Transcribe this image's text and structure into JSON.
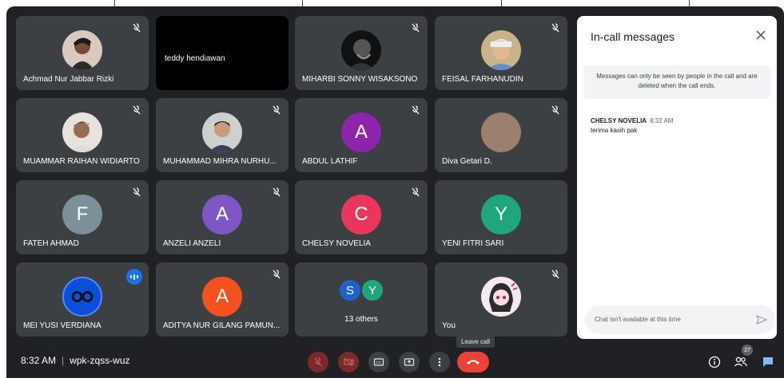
{
  "tiles": [
    {
      "name": "Achmad Nur Jabbar Rizki",
      "type": "photo",
      "muted": true
    },
    {
      "name": "teddy hendiawan",
      "type": "black",
      "muted": false
    },
    {
      "name": "MIHARBI SONNY WISAKSONO",
      "type": "photo",
      "muted": true
    },
    {
      "name": "FEISAL FARHANUDIN",
      "type": "photo",
      "muted": true
    },
    {
      "name": "MUAMMAR RAIHAN WIDIARTO",
      "type": "photo",
      "muted": true
    },
    {
      "name": "MUHAMMAD MIHRA NURHU...",
      "type": "photo",
      "muted": true
    },
    {
      "name": "ABDUL LATHIF",
      "type": "letter",
      "letter": "A",
      "color": "#8e24aa",
      "muted": true
    },
    {
      "name": "Diva Getari D.",
      "type": "photo",
      "muted": true
    },
    {
      "name": "FATEH AHMAD",
      "type": "letter",
      "letter": "F",
      "color": "#7b9099",
      "muted": true
    },
    {
      "name": "ANZELI ANZELI",
      "type": "letter",
      "letter": "A",
      "color": "#7e57c2",
      "muted": true
    },
    {
      "name": "CHELSY NOVELIA",
      "type": "letter",
      "letter": "C",
      "color": "#e8365d",
      "muted": true
    },
    {
      "name": "YENI FITRI SARI",
      "type": "letter",
      "letter": "Y",
      "color": "#20a67b",
      "muted": false
    },
    {
      "name": "MEI YUSI VERDIANA",
      "type": "photo",
      "speaking": true
    },
    {
      "name": "ADITYA NUR GILANG PAMUN...",
      "type": "letter",
      "letter": "A",
      "color": "#f4511e",
      "muted": true
    },
    {
      "type": "others",
      "letters": [
        "S",
        "Y"
      ],
      "label": "13 others"
    },
    {
      "name": "You",
      "type": "photo",
      "muted": true
    }
  ],
  "panel": {
    "title": "In-call messages",
    "notice": "Messages can only be seen by people in the call and are deleted when the call ends.",
    "message": {
      "sender": "CHELSY NOVELIA",
      "time": "8:32 AM",
      "text": "terima kasih pak"
    },
    "chat_placeholder": "Chat isn't available at this time"
  },
  "footer": {
    "time": "8:32 AM",
    "separator": "|",
    "meeting_code": "wpk-zqss-wuz",
    "tooltip": "Leave call",
    "participant_count": "27"
  },
  "colors": {
    "bg": "#202124",
    "tile": "#3c4043",
    "leave": "#ea4335",
    "chat_active": "#8ab4f8"
  }
}
